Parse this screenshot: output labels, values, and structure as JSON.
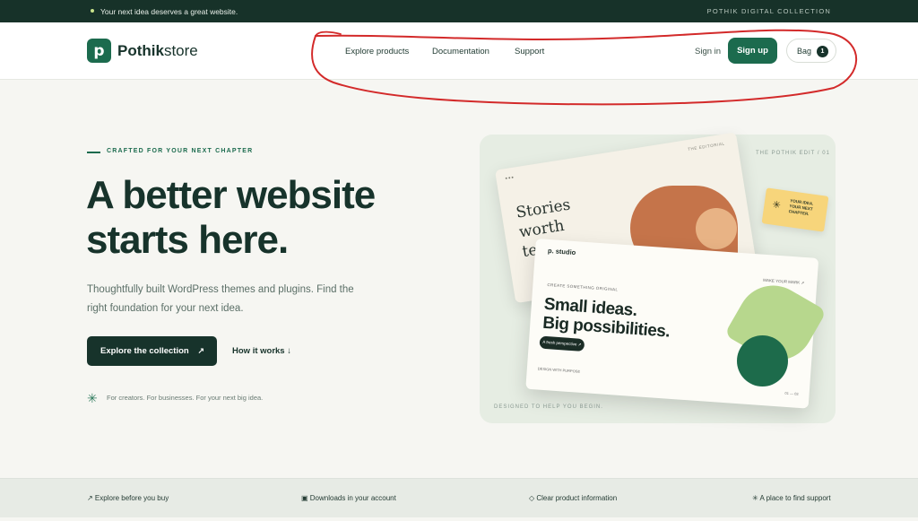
{
  "topbar": {
    "message": "Your next idea deserves a great website.",
    "brand": "POTHIK DIGITAL COLLECTION"
  },
  "header": {
    "logo_mark": "p",
    "logo_bold": "Pothik",
    "logo_rest": "store",
    "nav": [
      {
        "label": "Explore products"
      },
      {
        "label": "Documentation"
      },
      {
        "label": "Support"
      }
    ],
    "sign_in": "Sign in",
    "sign_up": "Sign up",
    "bag_label": "Bag",
    "bag_count": "1"
  },
  "hero": {
    "eyebrow": "CRAFTED FOR YOUR NEXT CHAPTER",
    "headline_line1": "A better website",
    "headline_line2": "starts here.",
    "subtext": "Thoughtfully built WordPress themes and plugins. Find the right foundation for your next idea.",
    "cta_label": "Explore the collection",
    "cta_arrow": "↗",
    "secondary_label": "How it works ↓",
    "note": "For creators. For businesses. For your next big idea."
  },
  "preview": {
    "tag": "THE POTHIK EDIT / 01",
    "footer": "DESIGNED TO HELP YOU BEGIN.",
    "back_card": {
      "dots": "•••",
      "tag": "THE EDITORIAL",
      "text_line1": "Stories",
      "text_line2": "worth",
      "text_line3": "telling"
    },
    "front_card": {
      "brand": "p. studio",
      "nav": "MAKE YOUR MARK ↗",
      "label": "CREATE SOMETHING ORIGINAL",
      "title_line1": "Small ideas.",
      "title_line2": "Big possibilities.",
      "button": "A fresh perspective ↗",
      "footer": "DESIGN WITH PURPOSE",
      "page": "01 — 03"
    },
    "sticky": {
      "line1": "YOUR IDEA.",
      "line2": "YOUR NEXT",
      "line3": "CHAPTER."
    }
  },
  "features": [
    {
      "label": "↗ Explore before you buy"
    },
    {
      "label": "▣ Downloads in your account"
    },
    {
      "label": "◇ Clear product information"
    },
    {
      "label": "✳ A place to find support"
    }
  ],
  "colors": {
    "brand_green": "#1c6b4e",
    "dark": "#17332b",
    "annotation_red": "#d32a2a"
  }
}
